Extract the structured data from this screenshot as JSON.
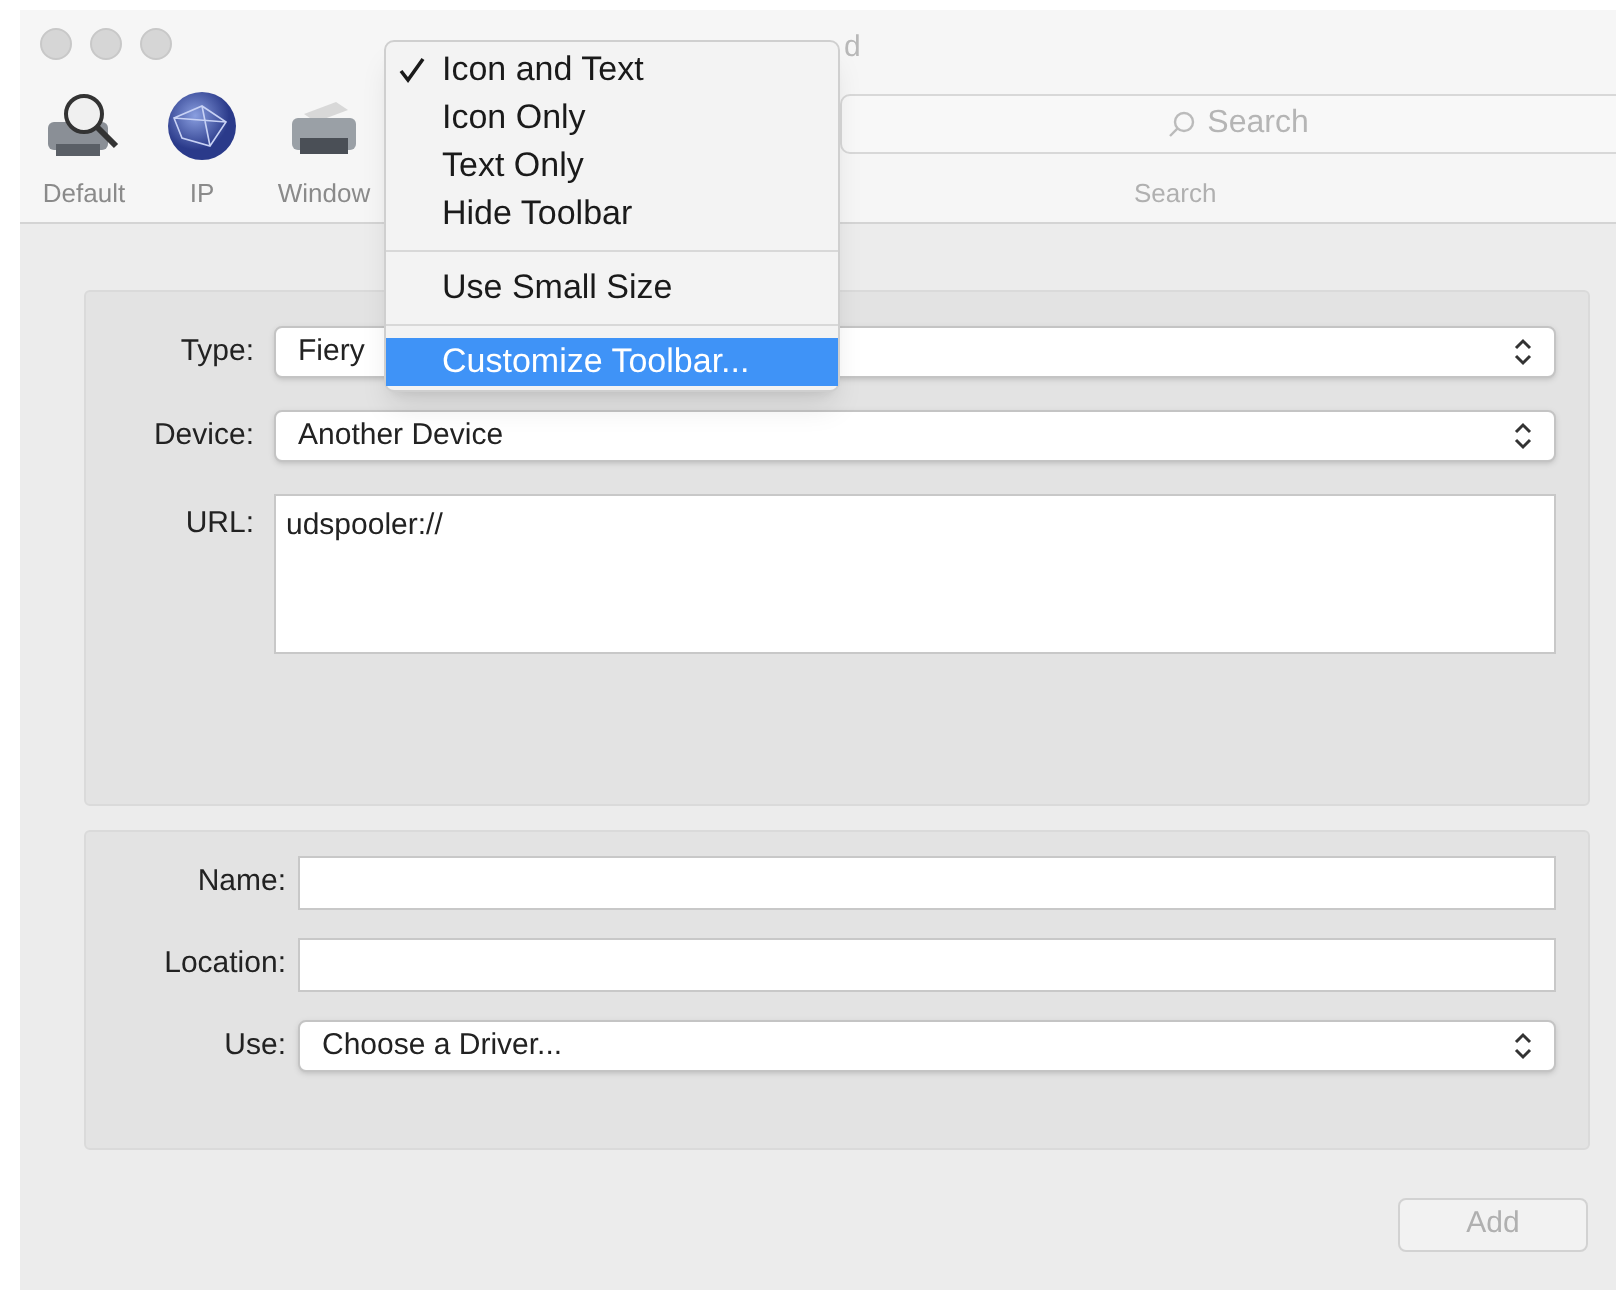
{
  "window": {
    "title": "d"
  },
  "toolbar": {
    "items": [
      {
        "label": "Default",
        "kind": "printer-search"
      },
      {
        "label": "IP",
        "kind": "globe"
      },
      {
        "label": "Window",
        "kind": "printer"
      }
    ],
    "search": {
      "placeholder": "Search",
      "label": "Search"
    }
  },
  "menu": {
    "items": [
      {
        "kind": "item",
        "label": "Icon and Text",
        "checked": true,
        "selected": false
      },
      {
        "kind": "item",
        "label": "Icon Only",
        "checked": false,
        "selected": false
      },
      {
        "kind": "item",
        "label": "Text Only",
        "checked": false,
        "selected": false
      },
      {
        "kind": "item",
        "label": "Hide Toolbar",
        "checked": false,
        "selected": false
      },
      {
        "kind": "separator"
      },
      {
        "kind": "item",
        "label": "Use Small Size",
        "checked": false,
        "selected": false
      },
      {
        "kind": "separator"
      },
      {
        "kind": "item",
        "label": "Customize Toolbar...",
        "checked": false,
        "selected": true
      }
    ]
  },
  "form": {
    "top": [
      {
        "kind": "select",
        "label": "Type:",
        "value": "Fiery"
      },
      {
        "kind": "select",
        "label": "Device:",
        "value": "Another Device"
      },
      {
        "kind": "textarea",
        "label": "URL:",
        "value": "udspooler://"
      }
    ],
    "bottom": [
      {
        "kind": "input",
        "label": "Name:"
      },
      {
        "kind": "input",
        "label": "Location:"
      },
      {
        "kind": "select",
        "label": "Use:",
        "value": "Choose a Driver..."
      }
    ]
  },
  "buttons": [
    {
      "label": "Add",
      "disabled": true
    }
  ]
}
